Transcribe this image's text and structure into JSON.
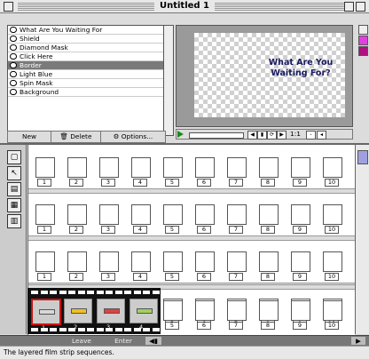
{
  "window": {
    "title": "Untitled 1"
  },
  "layers": [
    {
      "label": "What Are You Waiting For",
      "selected": false
    },
    {
      "label": "Shield",
      "selected": false
    },
    {
      "label": "Diamond Mask",
      "selected": false
    },
    {
      "label": "Click Here",
      "selected": false
    },
    {
      "label": "Border",
      "selected": true
    },
    {
      "label": "Light Blue",
      "selected": false
    },
    {
      "label": "Spin Mask",
      "selected": false
    },
    {
      "label": "Background",
      "selected": false
    }
  ],
  "layer_buttons": {
    "new": "New",
    "delete": "Delete",
    "options": "Options..."
  },
  "preview": {
    "text_line1": "What Are You",
    "text_line2": "Waiting For?"
  },
  "playback": {
    "zoom": "1:1"
  },
  "frame_numbers": [
    "1",
    "2",
    "3",
    "4",
    "5",
    "6",
    "7",
    "8",
    "9",
    "10"
  ],
  "bottom": {
    "leave": "Leave",
    "enter": "Enter"
  },
  "status": "The layered film strip sequences.",
  "colors": {
    "selected_layer": "#7a7a7a",
    "film_selection": "#d01010",
    "preview_text": "#1a1a60"
  }
}
